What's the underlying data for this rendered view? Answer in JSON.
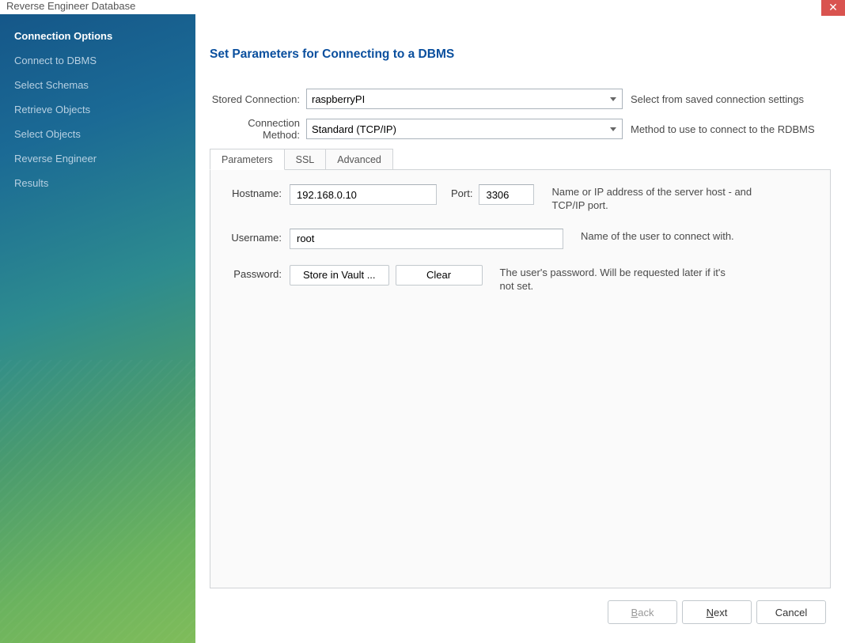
{
  "window": {
    "title": "Reverse Engineer Database"
  },
  "sidebar": {
    "items": [
      {
        "label": "Connection Options",
        "active": true
      },
      {
        "label": "Connect to DBMS",
        "active": false
      },
      {
        "label": "Select Schemas",
        "active": false
      },
      {
        "label": "Retrieve Objects",
        "active": false
      },
      {
        "label": "Select Objects",
        "active": false
      },
      {
        "label": "Reverse Engineer",
        "active": false
      },
      {
        "label": "Results",
        "active": false
      }
    ]
  },
  "page": {
    "title": "Set Parameters for Connecting to a DBMS",
    "stored_connection_label": "Stored Connection:",
    "stored_connection_value": "raspberryPI",
    "stored_connection_hint": "Select from saved connection settings",
    "connection_method_label": "Connection Method:",
    "connection_method_value": "Standard (TCP/IP)",
    "connection_method_hint": "Method to use to connect to the RDBMS",
    "tabs": [
      {
        "label": "Parameters",
        "active": true
      },
      {
        "label": "SSL",
        "active": false
      },
      {
        "label": "Advanced",
        "active": false
      }
    ],
    "params": {
      "hostname_label": "Hostname:",
      "hostname_value": "192.168.0.10",
      "port_label": "Port:",
      "port_value": "3306",
      "hostname_hint": "Name or IP address of the server host - and TCP/IP port.",
      "username_label": "Username:",
      "username_value": "root",
      "username_hint": "Name of the user to connect with.",
      "password_label": "Password:",
      "store_in_vault_btn": "Store in Vault ...",
      "clear_btn": "Clear",
      "password_hint": "The user's password. Will be requested later if it's not set."
    }
  },
  "footer": {
    "back": "Back",
    "next": "Next",
    "cancel": "Cancel"
  }
}
